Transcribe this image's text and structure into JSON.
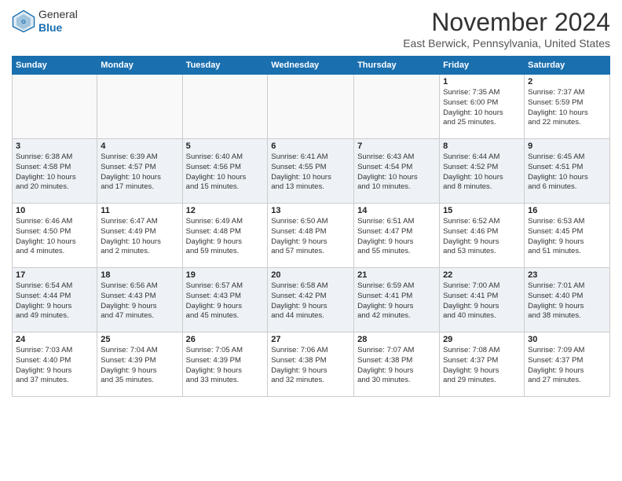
{
  "header": {
    "logo_line1": "General",
    "logo_line2": "Blue",
    "month_title": "November 2024",
    "location": "East Berwick, Pennsylvania, United States"
  },
  "days_of_week": [
    "Sunday",
    "Monday",
    "Tuesday",
    "Wednesday",
    "Thursday",
    "Friday",
    "Saturday"
  ],
  "weeks": [
    [
      {
        "day": "",
        "info": ""
      },
      {
        "day": "",
        "info": ""
      },
      {
        "day": "",
        "info": ""
      },
      {
        "day": "",
        "info": ""
      },
      {
        "day": "",
        "info": ""
      },
      {
        "day": "1",
        "info": "Sunrise: 7:35 AM\nSunset: 6:00 PM\nDaylight: 10 hours\nand 25 minutes."
      },
      {
        "day": "2",
        "info": "Sunrise: 7:37 AM\nSunset: 5:59 PM\nDaylight: 10 hours\nand 22 minutes."
      }
    ],
    [
      {
        "day": "3",
        "info": "Sunrise: 6:38 AM\nSunset: 4:58 PM\nDaylight: 10 hours\nand 20 minutes."
      },
      {
        "day": "4",
        "info": "Sunrise: 6:39 AM\nSunset: 4:57 PM\nDaylight: 10 hours\nand 17 minutes."
      },
      {
        "day": "5",
        "info": "Sunrise: 6:40 AM\nSunset: 4:56 PM\nDaylight: 10 hours\nand 15 minutes."
      },
      {
        "day": "6",
        "info": "Sunrise: 6:41 AM\nSunset: 4:55 PM\nDaylight: 10 hours\nand 13 minutes."
      },
      {
        "day": "7",
        "info": "Sunrise: 6:43 AM\nSunset: 4:54 PM\nDaylight: 10 hours\nand 10 minutes."
      },
      {
        "day": "8",
        "info": "Sunrise: 6:44 AM\nSunset: 4:52 PM\nDaylight: 10 hours\nand 8 minutes."
      },
      {
        "day": "9",
        "info": "Sunrise: 6:45 AM\nSunset: 4:51 PM\nDaylight: 10 hours\nand 6 minutes."
      }
    ],
    [
      {
        "day": "10",
        "info": "Sunrise: 6:46 AM\nSunset: 4:50 PM\nDaylight: 10 hours\nand 4 minutes."
      },
      {
        "day": "11",
        "info": "Sunrise: 6:47 AM\nSunset: 4:49 PM\nDaylight: 10 hours\nand 2 minutes."
      },
      {
        "day": "12",
        "info": "Sunrise: 6:49 AM\nSunset: 4:48 PM\nDaylight: 9 hours\nand 59 minutes."
      },
      {
        "day": "13",
        "info": "Sunrise: 6:50 AM\nSunset: 4:48 PM\nDaylight: 9 hours\nand 57 minutes."
      },
      {
        "day": "14",
        "info": "Sunrise: 6:51 AM\nSunset: 4:47 PM\nDaylight: 9 hours\nand 55 minutes."
      },
      {
        "day": "15",
        "info": "Sunrise: 6:52 AM\nSunset: 4:46 PM\nDaylight: 9 hours\nand 53 minutes."
      },
      {
        "day": "16",
        "info": "Sunrise: 6:53 AM\nSunset: 4:45 PM\nDaylight: 9 hours\nand 51 minutes."
      }
    ],
    [
      {
        "day": "17",
        "info": "Sunrise: 6:54 AM\nSunset: 4:44 PM\nDaylight: 9 hours\nand 49 minutes."
      },
      {
        "day": "18",
        "info": "Sunrise: 6:56 AM\nSunset: 4:43 PM\nDaylight: 9 hours\nand 47 minutes."
      },
      {
        "day": "19",
        "info": "Sunrise: 6:57 AM\nSunset: 4:43 PM\nDaylight: 9 hours\nand 45 minutes."
      },
      {
        "day": "20",
        "info": "Sunrise: 6:58 AM\nSunset: 4:42 PM\nDaylight: 9 hours\nand 44 minutes."
      },
      {
        "day": "21",
        "info": "Sunrise: 6:59 AM\nSunset: 4:41 PM\nDaylight: 9 hours\nand 42 minutes."
      },
      {
        "day": "22",
        "info": "Sunrise: 7:00 AM\nSunset: 4:41 PM\nDaylight: 9 hours\nand 40 minutes."
      },
      {
        "day": "23",
        "info": "Sunrise: 7:01 AM\nSunset: 4:40 PM\nDaylight: 9 hours\nand 38 minutes."
      }
    ],
    [
      {
        "day": "24",
        "info": "Sunrise: 7:03 AM\nSunset: 4:40 PM\nDaylight: 9 hours\nand 37 minutes."
      },
      {
        "day": "25",
        "info": "Sunrise: 7:04 AM\nSunset: 4:39 PM\nDaylight: 9 hours\nand 35 minutes."
      },
      {
        "day": "26",
        "info": "Sunrise: 7:05 AM\nSunset: 4:39 PM\nDaylight: 9 hours\nand 33 minutes."
      },
      {
        "day": "27",
        "info": "Sunrise: 7:06 AM\nSunset: 4:38 PM\nDaylight: 9 hours\nand 32 minutes."
      },
      {
        "day": "28",
        "info": "Sunrise: 7:07 AM\nSunset: 4:38 PM\nDaylight: 9 hours\nand 30 minutes."
      },
      {
        "day": "29",
        "info": "Sunrise: 7:08 AM\nSunset: 4:37 PM\nDaylight: 9 hours\nand 29 minutes."
      },
      {
        "day": "30",
        "info": "Sunrise: 7:09 AM\nSunset: 4:37 PM\nDaylight: 9 hours\nand 27 minutes."
      }
    ]
  ]
}
